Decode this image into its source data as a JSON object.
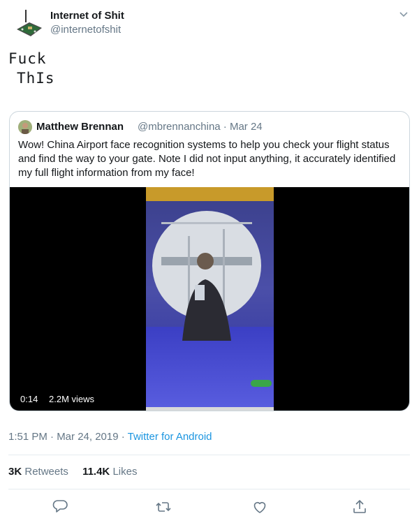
{
  "author": {
    "name": "Internet of Shit",
    "handle": "@internetofshit"
  },
  "tweet": {
    "line1": "Fuck",
    "line2": "ThIs"
  },
  "quote": {
    "name": "Matthew Brennan",
    "handle_date": "@mbrennanchina · Mar 24",
    "text": "Wow! China Airport face recognition systems to help you check your flight status and find the way to your gate. Note I did not input anything, it accurately identified my full flight information from my face!",
    "video": {
      "duration": "0:14",
      "views": "2.2M views"
    }
  },
  "meta": {
    "time_date": "1:51 PM · Mar 24, 2019 · ",
    "source": "Twitter for Android"
  },
  "stats": {
    "retweets_count": "3K",
    "retweets_label": "Retweets",
    "likes_count": "11.4K",
    "likes_label": "Likes"
  },
  "icons": {
    "reply": "reply-icon",
    "retweet": "retweet-icon",
    "like": "heart-icon",
    "share": "share-icon",
    "more": "chevron-down-icon"
  },
  "colors": {
    "link": "#1b95e0",
    "secondary_text": "#657786",
    "border": "#ccd6dd"
  }
}
